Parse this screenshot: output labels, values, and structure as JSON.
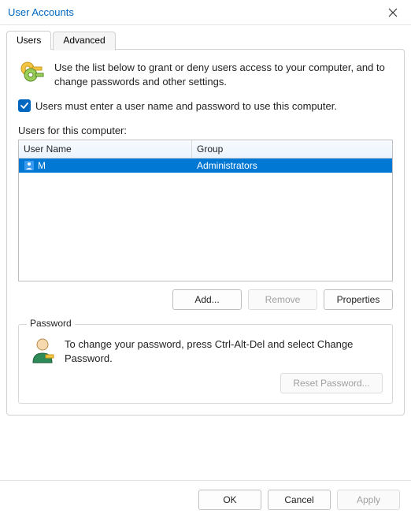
{
  "title": "User Accounts",
  "tabs": {
    "users": "Users",
    "advanced": "Advanced"
  },
  "intro_text": "Use the list below to grant or deny users access to your computer, and to change passwords and other settings.",
  "require_login_checkbox": {
    "checked": true,
    "label": "Users must enter a user name and password to use this computer."
  },
  "users_table": {
    "section_label": "Users for this computer:",
    "columns": {
      "name": "User Name",
      "group": "Group"
    },
    "rows": [
      {
        "name": "M",
        "group": "Administrators",
        "selected": true
      }
    ]
  },
  "buttons": {
    "add": "Add...",
    "remove": "Remove",
    "properties": "Properties"
  },
  "password_group": {
    "label": "Password",
    "text": "To change your password, press Ctrl-Alt-Del and select Change Password.",
    "reset_button": "Reset Password..."
  },
  "footer": {
    "ok": "OK",
    "cancel": "Cancel",
    "apply": "Apply"
  }
}
